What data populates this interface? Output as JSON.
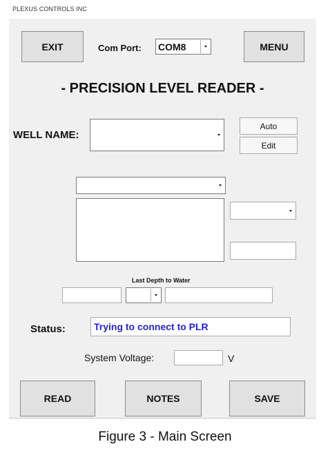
{
  "company": "PLEXUS CONTROLS INC",
  "toolbar": {
    "exit_label": "EXIT",
    "menu_label": "MENU",
    "com_port_label": "Com Port:",
    "com_port_value": "COM8"
  },
  "title": "- PRECISION LEVEL READER -",
  "well": {
    "label": "WELL NAME:",
    "value": "",
    "auto_label": "Auto",
    "edit_label": "Edit"
  },
  "last_depth_label": "Last Depth to Water",
  "status": {
    "label": "Status:",
    "value": "Trying to connect to PLR"
  },
  "voltage": {
    "label": "System Voltage:",
    "value": "",
    "unit": "V"
  },
  "bottom": {
    "read_label": "READ",
    "notes_label": "NOTES",
    "save_label": "SAVE"
  },
  "caption": "Figure 3  - Main Screen",
  "colors": {
    "status_text": "#2424c8",
    "window_bg": "#f0f0f0",
    "button_bg": "#e1e1e1"
  }
}
